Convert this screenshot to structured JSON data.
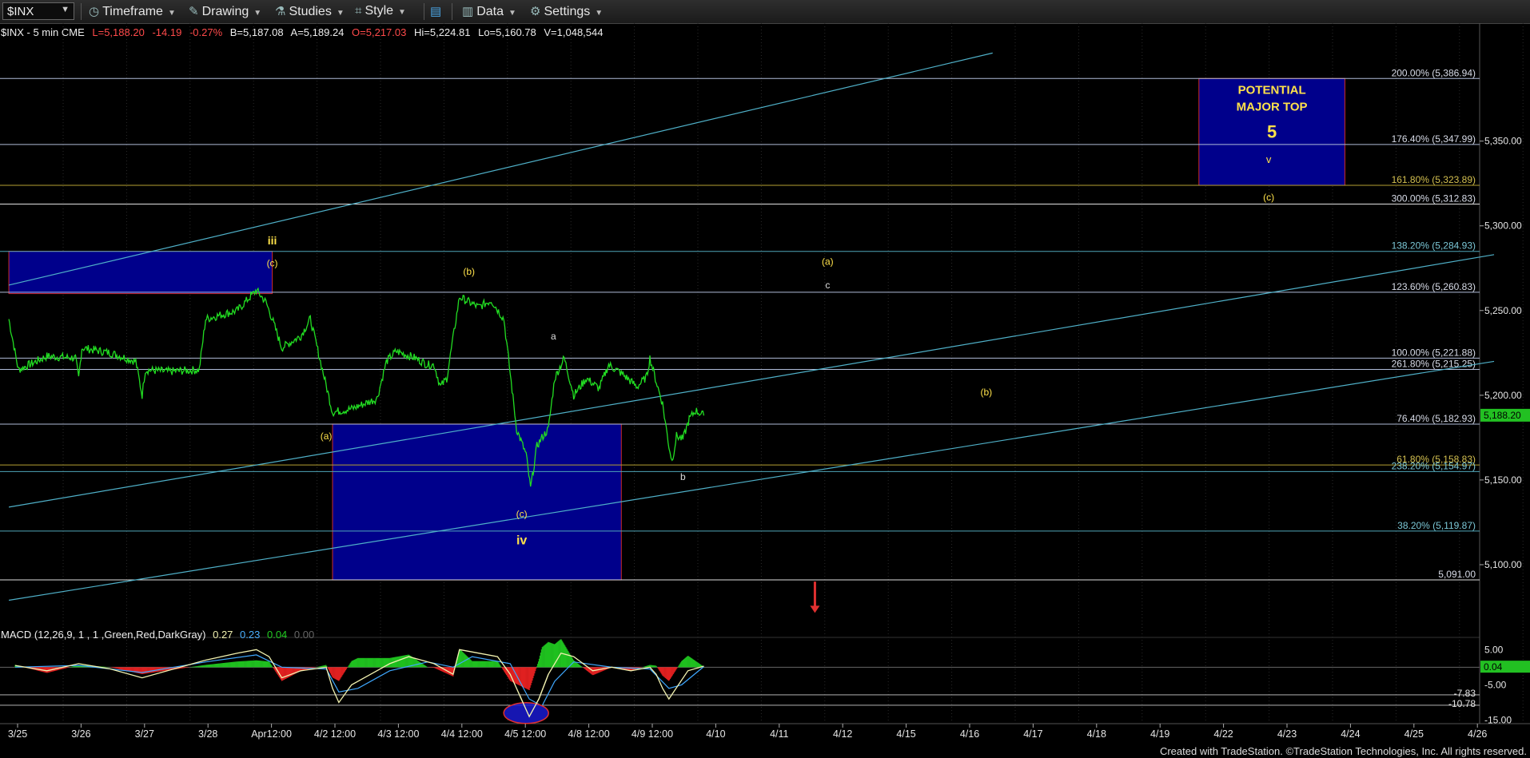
{
  "toolbar": {
    "symbol": "$INX",
    "items": [
      {
        "label": "Timeframe",
        "icon": "clock-icon"
      },
      {
        "label": "Drawing",
        "icon": "pencil-icon"
      },
      {
        "label": "Studies",
        "icon": "flask-icon"
      },
      {
        "label": "Style",
        "icon": "style-icon"
      },
      {
        "label": "",
        "icon": "panels-icon"
      },
      {
        "label": "Data",
        "icon": "bar-chart-icon"
      },
      {
        "label": "Settings",
        "icon": "gear-icon"
      }
    ]
  },
  "info": {
    "symbol_desc": "$INX - 5 min  CME",
    "last": "L=5,188.20",
    "change": "-14.19",
    "change_pct": "-0.27%",
    "bid": "B=5,187.08",
    "ask": "A=5,189.24",
    "open": "O=5,217.03",
    "high": "Hi=5,224.81",
    "low": "Lo=5,160.78",
    "volume": "V=1,048,544"
  },
  "macd_label": {
    "name": "MACD (12,26,9, 1 , 1 ,Green,Red,DarkGray)",
    "v1": "0.27",
    "v2": "0.23",
    "v3": "0.04",
    "v4": "0.00"
  },
  "credit": "Created with TradeStation. ©TradeStation Technologies, Inc. All rights reserved.",
  "colors": {
    "background": "#000000",
    "price": "#22dd22",
    "trendline": "#4fb0c8",
    "fib_line": "#b0bcd8",
    "box": "#00008b",
    "label_yellow": "#ffe24a",
    "negative": "#ff4040",
    "macd_line": "#f2f2b0",
    "signal_line": "#3fa8ff"
  },
  "chart_data": {
    "type": "line",
    "series_name": "$INX - 5 min",
    "ylim": [
      5075,
      5405
    ],
    "y_ticks": [
      5100,
      5150,
      5200,
      5250,
      5300,
      5350
    ],
    "y_tick_labels": [
      "5,100.00",
      "5,150.00",
      "5,200.00",
      "5,250.00",
      "5,300.00",
      "5,350.00"
    ],
    "last_price_label": "5,188.20",
    "x_tick_labels": [
      "3/25",
      "3/26",
      "3/27",
      "3/28",
      "Apr12:00",
      "4/2 12:00",
      "4/3 12:00",
      "4/4 12:00",
      "4/5 12:00",
      "4/8 12:00",
      "4/9 12:00",
      "4/10",
      "4/11",
      "4/12",
      "4/15",
      "4/16",
      "4/17",
      "4/18",
      "4/19",
      "4/22",
      "4/23",
      "4/24",
      "4/25",
      "4/26"
    ],
    "x_tick_index": [
      0,
      1,
      2,
      3,
      4,
      5,
      6,
      7,
      8,
      9,
      10,
      11,
      12,
      13,
      14,
      15,
      16,
      17,
      18,
      19,
      20,
      21,
      22,
      23
    ],
    "price_path": [
      [
        -0.1,
        5245
      ],
      [
        0.05,
        5215
      ],
      [
        0.5,
        5223
      ],
      [
        0.95,
        5222
      ],
      [
        1.0,
        5210
      ],
      [
        1.05,
        5228
      ],
      [
        1.5,
        5225
      ],
      [
        1.9,
        5220
      ],
      [
        2.0,
        5200
      ],
      [
        2.05,
        5215
      ],
      [
        2.4,
        5214
      ],
      [
        2.9,
        5215
      ],
      [
        3.0,
        5245
      ],
      [
        3.5,
        5250
      ],
      [
        3.8,
        5262
      ],
      [
        3.95,
        5255
      ],
      [
        4.05,
        5245
      ],
      [
        4.2,
        5228
      ],
      [
        4.5,
        5235
      ],
      [
        4.65,
        5245
      ],
      [
        5.0,
        5190
      ],
      [
        5.3,
        5192
      ],
      [
        5.7,
        5198
      ],
      [
        5.85,
        5220
      ],
      [
        6.0,
        5226
      ],
      [
        6.3,
        5222
      ],
      [
        6.5,
        5218
      ],
      [
        6.6,
        5218
      ],
      [
        6.7,
        5205
      ],
      [
        6.8,
        5210
      ],
      [
        7.0,
        5258
      ],
      [
        7.3,
        5252
      ],
      [
        7.5,
        5256
      ],
      [
        7.7,
        5245
      ],
      [
        7.9,
        5180
      ],
      [
        8.05,
        5165
      ],
      [
        8.12,
        5145
      ],
      [
        8.22,
        5170
      ],
      [
        8.3,
        5175
      ],
      [
        8.4,
        5180
      ],
      [
        8.5,
        5210
      ],
      [
        8.65,
        5222
      ],
      [
        8.8,
        5200
      ],
      [
        9.0,
        5210
      ],
      [
        9.2,
        5204
      ],
      [
        9.35,
        5218
      ],
      [
        9.55,
        5213
      ],
      [
        9.8,
        5205
      ],
      [
        9.95,
        5211
      ],
      [
        10.0,
        5222
      ],
      [
        10.1,
        5208
      ],
      [
        10.2,
        5195
      ],
      [
        10.3,
        5170
      ],
      [
        10.35,
        5161
      ],
      [
        10.42,
        5176
      ],
      [
        10.52,
        5174
      ],
      [
        10.62,
        5186
      ],
      [
        10.72,
        5191
      ],
      [
        10.85,
        5188
      ]
    ],
    "macd": {
      "ylim": [
        -16,
        8
      ],
      "tick_labels": [
        "5.00",
        "-5.00",
        "-15.00"
      ],
      "tick_values": [
        5,
        -5,
        -15
      ],
      "value_labels": [
        "0.04",
        "-7.83",
        "-10.78"
      ],
      "value_label_values": [
        0.04,
        -7.83,
        -10.78
      ],
      "macd_path": [
        [
          0,
          0.5
        ],
        [
          0.5,
          -1
        ],
        [
          1,
          1
        ],
        [
          1.5,
          -0.5
        ],
        [
          2,
          -3
        ],
        [
          2.5,
          -0.5
        ],
        [
          3,
          2
        ],
        [
          3.5,
          4
        ],
        [
          3.8,
          5
        ],
        [
          4,
          3
        ],
        [
          4.2,
          -3
        ],
        [
          4.5,
          -1
        ],
        [
          4.9,
          0
        ],
        [
          5.0,
          -6
        ],
        [
          5.1,
          -10
        ],
        [
          5.3,
          -5
        ],
        [
          5.6,
          -2
        ],
        [
          5.9,
          1
        ],
        [
          6.2,
          3
        ],
        [
          6.6,
          1
        ],
        [
          6.9,
          -2
        ],
        [
          7.0,
          5
        ],
        [
          7.3,
          4
        ],
        [
          7.6,
          3
        ],
        [
          7.8,
          -2
        ],
        [
          7.95,
          -8
        ],
        [
          8.1,
          -14
        ],
        [
          8.25,
          -9
        ],
        [
          8.4,
          -2
        ],
        [
          8.6,
          4
        ],
        [
          8.8,
          3
        ],
        [
          9.1,
          -1
        ],
        [
          9.4,
          0
        ],
        [
          9.7,
          -1
        ],
        [
          10.0,
          0
        ],
        [
          10.1,
          -2
        ],
        [
          10.2,
          -6
        ],
        [
          10.3,
          -9
        ],
        [
          10.45,
          -5
        ],
        [
          10.6,
          -1
        ],
        [
          10.85,
          0.3
        ]
      ],
      "signal_path": [
        [
          0,
          0
        ],
        [
          1,
          0.5
        ],
        [
          2,
          -1.5
        ],
        [
          3,
          1.5
        ],
        [
          3.8,
          3.5
        ],
        [
          4.2,
          0
        ],
        [
          4.9,
          -0.5
        ],
        [
          5.1,
          -7
        ],
        [
          5.4,
          -6
        ],
        [
          5.9,
          -1
        ],
        [
          6.5,
          1.5
        ],
        [
          6.9,
          0
        ],
        [
          7.2,
          3
        ],
        [
          7.8,
          1
        ],
        [
          8.1,
          -9
        ],
        [
          8.3,
          -11
        ],
        [
          8.5,
          -4
        ],
        [
          8.8,
          1.5
        ],
        [
          9.4,
          0
        ],
        [
          10.0,
          -0.5
        ],
        [
          10.3,
          -6
        ],
        [
          10.5,
          -5
        ],
        [
          10.85,
          0.2
        ]
      ]
    },
    "fib_levels": [
      {
        "label": "200.00% (5,386.94)",
        "value": 5386.94,
        "color": "#b0bcd8"
      },
      {
        "label": "176.40% (5,347.99)",
        "value": 5347.99,
        "color": "#b0bcd8"
      },
      {
        "label": "161.80% (5,323.89)",
        "value": 5323.89,
        "color": "#b5a032"
      },
      {
        "label": "300.00% (5,312.83)",
        "value": 5312.83,
        "color": "#e0e0e0"
      },
      {
        "label": "138.20% (5,284.93)",
        "value": 5284.93,
        "color": "#4fa6b8"
      },
      {
        "label": "123.60% (5,260.83)",
        "value": 5260.83,
        "color": "#b0bcd8"
      },
      {
        "label": "100.00% (5,221.88)",
        "value": 5221.88,
        "color": "#b0bcd8"
      },
      {
        "label": "261.80% (5,215.25)",
        "value": 5215.25,
        "color": "#b0bcd8"
      },
      {
        "label": "76.40% (5,182.93)",
        "value": 5182.93,
        "color": "#b0bcd8"
      },
      {
        "label": "61.80% (5,158.83)",
        "value": 5158.83,
        "color": "#b5a032"
      },
      {
        "label": "238.20% (5,154.97)",
        "value": 5154.97,
        "color": "#4fa6b8"
      },
      {
        "label": "38.20% (5,119.87)",
        "value": 5119.87,
        "color": "#4fa6b8"
      },
      {
        "label": "5,091.00",
        "value": 5091.0,
        "color": "#e0e0e0"
      }
    ],
    "trendlines": [
      {
        "from": [
          -0.1,
          5265
        ],
        "to": [
          15.4,
          5402
        ]
      },
      {
        "from": [
          -0.1,
          5134
        ],
        "to": [
          23.3,
          5283
        ]
      },
      {
        "from": [
          -0.1,
          5079
        ],
        "to": [
          23.3,
          5220
        ]
      }
    ],
    "boxes": [
      {
        "x0": -0.1,
        "x1": 4.05,
        "y_top": 5285,
        "y_bottom": 5260
      },
      {
        "x0": 5.0,
        "x1": 9.55,
        "y_top": 5183,
        "y_bottom": 5091
      },
      {
        "x0": 18.65,
        "x1": 20.95,
        "y_top": 5386.94,
        "y_bottom": 5323.89
      }
    ],
    "box_text": [
      {
        "text": "POTENTIAL",
        "x": 19.8,
        "y": 5378,
        "size": 15,
        "color": "#ffe24a",
        "bold": true
      },
      {
        "text": "MAJOR TOP",
        "x": 19.8,
        "y": 5368,
        "size": 15,
        "color": "#ffe24a",
        "bold": true
      },
      {
        "text": "5",
        "x": 19.8,
        "y": 5352,
        "size": 22,
        "color": "#ffe24a",
        "bold": true
      },
      {
        "text": "v",
        "x": 19.75,
        "y": 5337,
        "size": 13,
        "color": "#ffe24a",
        "bold": false
      },
      {
        "text": "(c)",
        "x": 19.75,
        "y": 5315,
        "size": 12,
        "color": "#ffe24a",
        "bold": false
      }
    ],
    "wave_labels": [
      {
        "text": "iii",
        "x": 4.05,
        "y": 5289,
        "color": "#ffe24a",
        "size": 14,
        "bold": true
      },
      {
        "text": "(c)",
        "x": 4.05,
        "y": 5276,
        "color": "#ffe24a",
        "size": 12,
        "bold": false
      },
      {
        "text": "(b)",
        "x": 7.15,
        "y": 5271,
        "color": "#ffe24a",
        "size": 12,
        "bold": false
      },
      {
        "text": "(a)",
        "x": 4.9,
        "y": 5174,
        "color": "#ffe24a",
        "size": 12,
        "bold": false
      },
      {
        "text": "(c)",
        "x": 7.98,
        "y": 5128,
        "color": "#ffe24a",
        "size": 12,
        "bold": false
      },
      {
        "text": "iv",
        "x": 7.98,
        "y": 5112,
        "color": "#ffe24a",
        "size": 16,
        "bold": true
      },
      {
        "text": "a",
        "x": 8.48,
        "y": 5233,
        "color": "#dddddd",
        "size": 12,
        "bold": false
      },
      {
        "text": "b",
        "x": 10.52,
        "y": 5150,
        "color": "#dddddd",
        "size": 12,
        "bold": false
      },
      {
        "text": "(a)",
        "x": 12.8,
        "y": 5277,
        "color": "#ffe24a",
        "size": 12,
        "bold": false
      },
      {
        "text": "c",
        "x": 12.8,
        "y": 5263,
        "color": "#dddddd",
        "size": 12,
        "bold": false
      },
      {
        "text": "(b)",
        "x": 15.3,
        "y": 5200,
        "color": "#ffe24a",
        "size": 12,
        "bold": false
      }
    ],
    "arrow": {
      "x": 12.6,
      "y_from": 5090,
      "y_to": 5072,
      "color": "#e03030"
    },
    "macd_ellipse": {
      "x": 8.05,
      "y": -13
    }
  }
}
